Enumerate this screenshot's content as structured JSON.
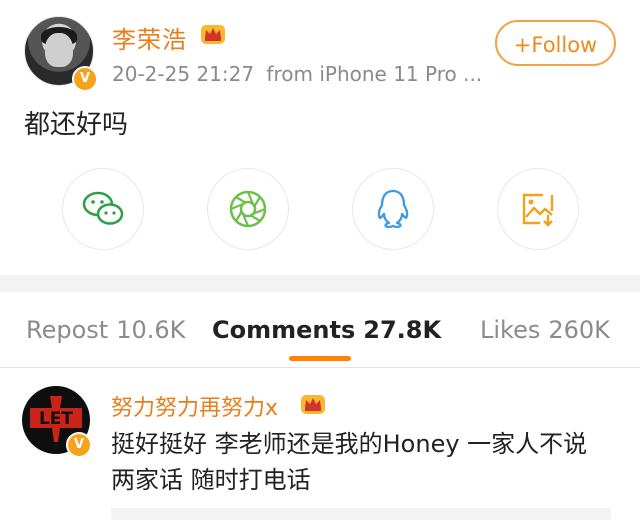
{
  "post": {
    "author_name": "李荣浩",
    "timestamp": "20-2-25 21:27",
    "source": "from iPhone 11 Pro ...",
    "follow_label": "+Follow",
    "content": "都还好吗",
    "verified_mark": "V",
    "share_targets": [
      "wechat-icon",
      "wechat-moments-icon",
      "qq-icon",
      "save-image-icon"
    ]
  },
  "tabs": [
    {
      "label": "Repost",
      "count": "10.6K"
    },
    {
      "label": "Comments",
      "count": "27.8K"
    },
    {
      "label": "Likes",
      "count": "260K"
    }
  ],
  "comment": {
    "author_name": "努力努力再努力x",
    "text": "挺好挺好 李老师还是我的Honey 一家人不说两家话 随时打电话",
    "verified_mark": "V",
    "avatar_text": "LET"
  },
  "colors": {
    "accent": "#ff8200",
    "name": "#ea7d1a",
    "wechat": "#2aa043",
    "moments": "#6cc04a",
    "qq": "#3c9be3",
    "save": "#f0a21c"
  }
}
